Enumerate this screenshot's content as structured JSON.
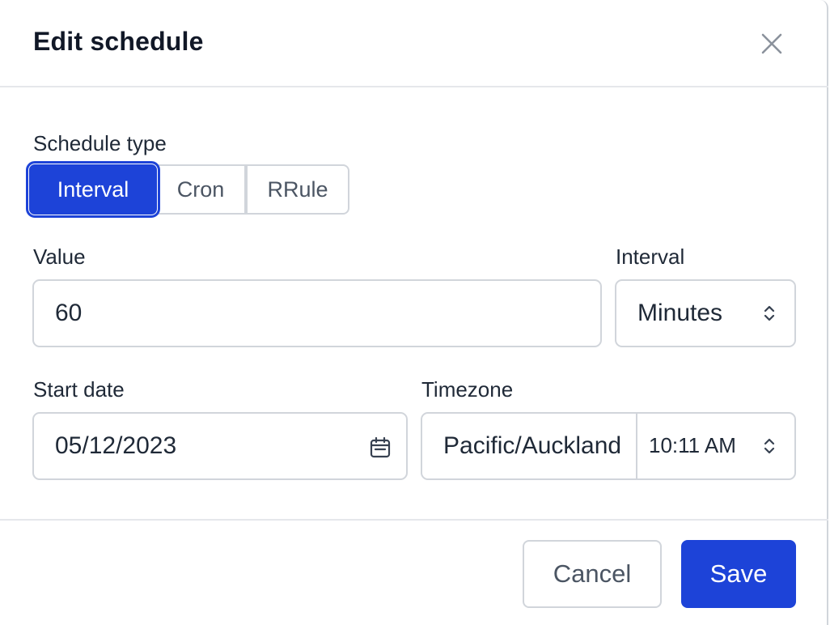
{
  "dialog": {
    "title": "Edit schedule",
    "close_icon": "close-icon"
  },
  "schedule_type": {
    "label": "Schedule type",
    "options": [
      "Interval",
      "Cron",
      "RRule"
    ],
    "selected": "Interval"
  },
  "value": {
    "label": "Value",
    "current": "60"
  },
  "interval": {
    "label": "Interval",
    "selected": "Minutes",
    "icon": "chevron-updown-icon"
  },
  "start_date": {
    "label": "Start date",
    "date": "05/12/2023",
    "icon": "calendar-icon"
  },
  "timezone": {
    "label": "Timezone",
    "zone": "Pacific/Auckland",
    "time": "10:11 AM",
    "icon": "chevron-updown-icon"
  },
  "footer": {
    "cancel_label": "Cancel",
    "save_label": "Save"
  },
  "colors": {
    "accent": "#1d43d8",
    "border": "#d1d5db",
    "text": "#111827"
  }
}
